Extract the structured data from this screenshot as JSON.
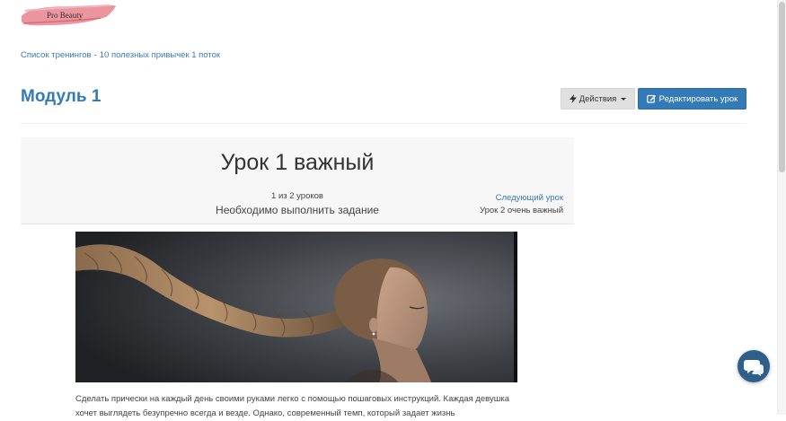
{
  "brand": {
    "name": "Pro Beauty",
    "accent": "#e57a86"
  },
  "breadcrumb": {
    "items": [
      "Список тренингов",
      "10 полезных привычек 1 поток"
    ],
    "separator": "-"
  },
  "header": {
    "title": "Модуль 1",
    "actions_label": "Действия",
    "edit_label": "Редактировать урок"
  },
  "lesson": {
    "title": "Урок 1 важный",
    "position": "1 из 2 уроков",
    "task_note": "Необходимо выполнить задание",
    "next_label": "Следующий урок",
    "next_title": "Урок 2 очень важный"
  },
  "content": {
    "text": "Сделать прически на каждый день своими руками легко с помощью пошаговых инструкций. Каждая девушка хочет выглядеть безупречно всегда и везде. Однако, современный темп, который задает жизнь"
  },
  "colors": {
    "primary": "#337ab7",
    "link": "#3a78b5",
    "chat": "#2e5e8a"
  },
  "icons": {
    "actions": "bolt-icon",
    "edit": "edit-icon",
    "chat": "chat-icon"
  }
}
